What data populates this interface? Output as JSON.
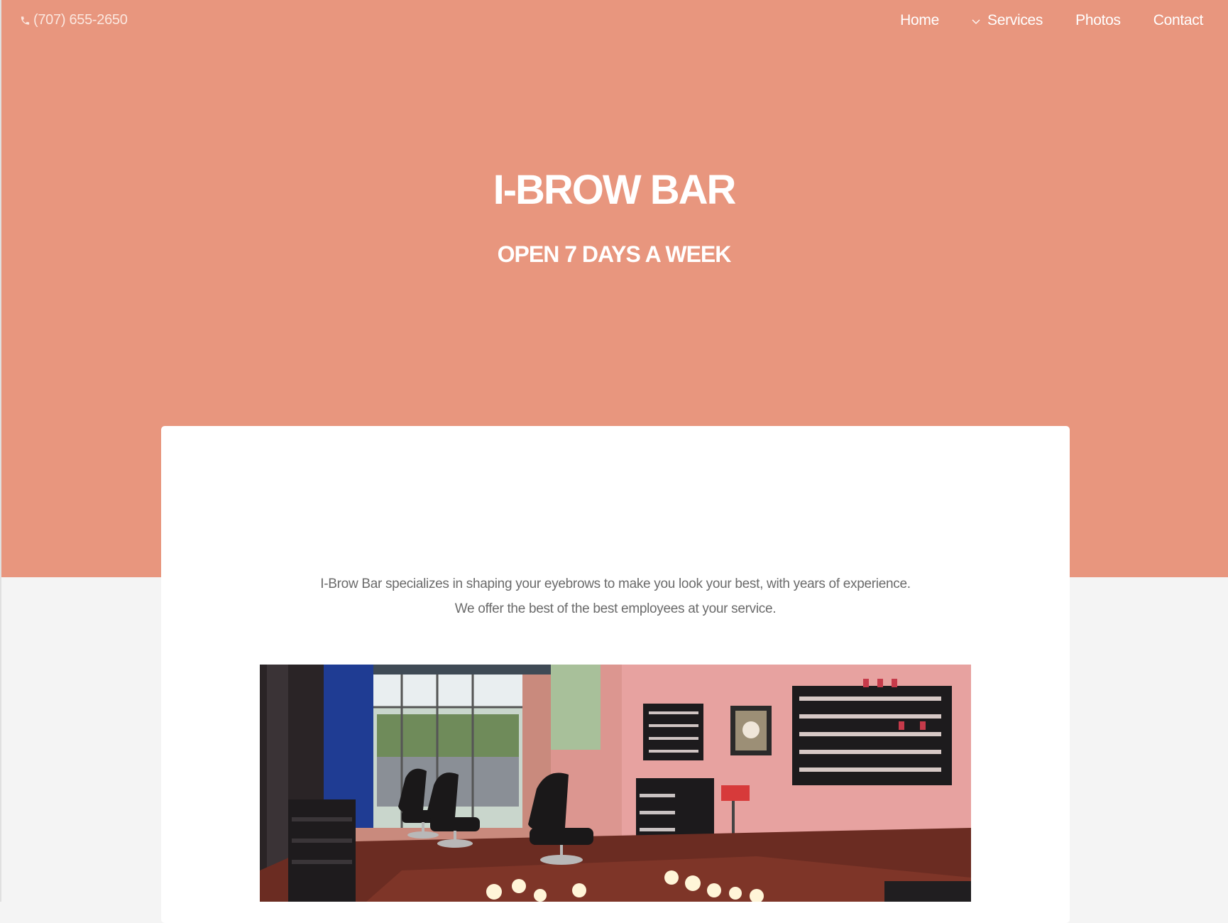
{
  "header": {
    "phone": "(707) 655-2650",
    "phone_icon": "phone-icon",
    "nav": [
      {
        "label": "Home"
      },
      {
        "label": "Services",
        "icon": "chevron-down-icon"
      },
      {
        "label": "Photos"
      },
      {
        "label": "Contact"
      }
    ]
  },
  "hero": {
    "title": "I-BROW BAR",
    "subtitle": "OPEN 7 DAYS A WEEK"
  },
  "content": {
    "intro_line_1": "I-Brow Bar specializes in shaping your eyebrows to make you look your best, with years of experience.",
    "intro_line_2": "We offer the best of the best employees at your service."
  },
  "colors": {
    "hero_bg": "#e8967e",
    "page_bg": "#f4f4f4",
    "card_bg": "#ffffff",
    "nav_text": "#ffffff",
    "body_text": "#6b6b6b"
  }
}
